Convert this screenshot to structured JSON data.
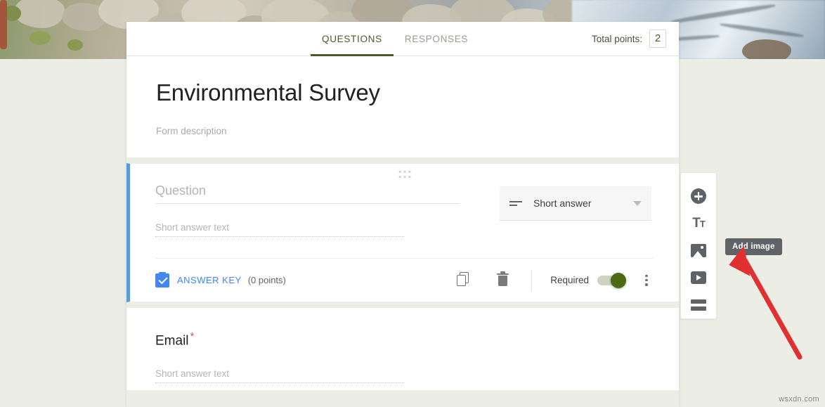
{
  "banner": {
    "alt": "rocky-shoreline-header-image"
  },
  "tabs": [
    {
      "label": "QUESTIONS",
      "active": true
    },
    {
      "label": "RESPONSES",
      "active": false
    }
  ],
  "header": {
    "total_points_label": "Total points:",
    "total_points_value": "2"
  },
  "form": {
    "title": "Environmental Survey",
    "description_placeholder": "Form description"
  },
  "question": {
    "title_placeholder": "Question",
    "answer_placeholder": "Short answer text",
    "type_label": "Short answer",
    "answer_key_label": "ANSWER KEY",
    "answer_key_points": "(0 points)",
    "required_label": "Required",
    "required_on": true
  },
  "email_question": {
    "title": "Email",
    "required_mark": "*",
    "answer_placeholder": "Short answer text"
  },
  "toolbar": {
    "items": [
      {
        "name": "add-question",
        "icon": "plus-circle-icon"
      },
      {
        "name": "add-title-and-description",
        "icon": "title-text-icon"
      },
      {
        "name": "add-image",
        "icon": "image-icon"
      },
      {
        "name": "add-video",
        "icon": "video-icon"
      },
      {
        "name": "add-section",
        "icon": "section-icon"
      }
    ]
  },
  "tooltip": {
    "text": "Add image"
  },
  "watermark": {
    "text": "wsxdn.com"
  },
  "colors": {
    "accent_green": "#4a5a2b",
    "question_stripe_blue": "#5b9bd5",
    "answer_key_blue": "#4285f4",
    "toggle_on_green": "#4a6a14",
    "tooltip_bg": "#5f6368",
    "annotation_red": "#e03030",
    "page_background": "#eceee6"
  }
}
